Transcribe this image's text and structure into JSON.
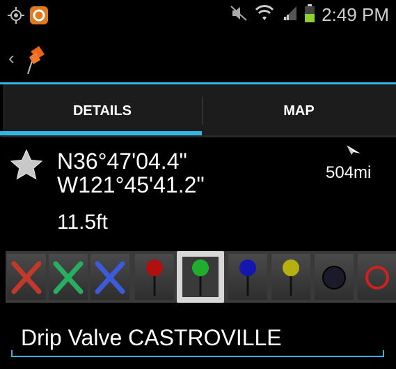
{
  "status_bar": {
    "time": "2:49 PM",
    "icons": [
      "gps-icon",
      "app-notification-icon",
      "mute-icon",
      "wifi-icon",
      "signal-icon",
      "battery-icon"
    ]
  },
  "action_bar": {
    "back_icon": "chevron-left-icon",
    "app_icon": "push-pin-icon"
  },
  "tabs": [
    {
      "label": "DETAILS",
      "selected": true
    },
    {
      "label": "MAP",
      "selected": false
    }
  ],
  "details": {
    "latitude": "N36°47'04.4\"",
    "longitude": "W121°45'41.2\"",
    "elevation": "11.5ft",
    "distance": "504mi",
    "favorite_icon": "star-icon",
    "direction_icon": "direction-arrow-icon"
  },
  "markers": [
    {
      "name": "red-x",
      "color": "#c0392b",
      "shape": "x"
    },
    {
      "name": "green-x",
      "color": "#27ae60",
      "shape": "x"
    },
    {
      "name": "blue-x",
      "color": "#3b5bdb",
      "shape": "x"
    },
    {
      "name": "red-pin",
      "color": "#b01010",
      "shape": "pin"
    },
    {
      "name": "green-pin",
      "color": "#1fae2f",
      "shape": "pin",
      "selected": true
    },
    {
      "name": "blue-pin",
      "color": "#1515b0",
      "shape": "pin"
    },
    {
      "name": "yellow-pin",
      "color": "#b5b010",
      "shape": "pin"
    },
    {
      "name": "black-circle",
      "color": "#1a1a2a",
      "shape": "dot"
    },
    {
      "name": "red-circle",
      "color": "#d02020",
      "shape": "ring"
    }
  ],
  "waypoint_name": "Drip Valve CASTROVILLE",
  "colors": {
    "accent": "#33b5e5",
    "background": "#000000"
  }
}
